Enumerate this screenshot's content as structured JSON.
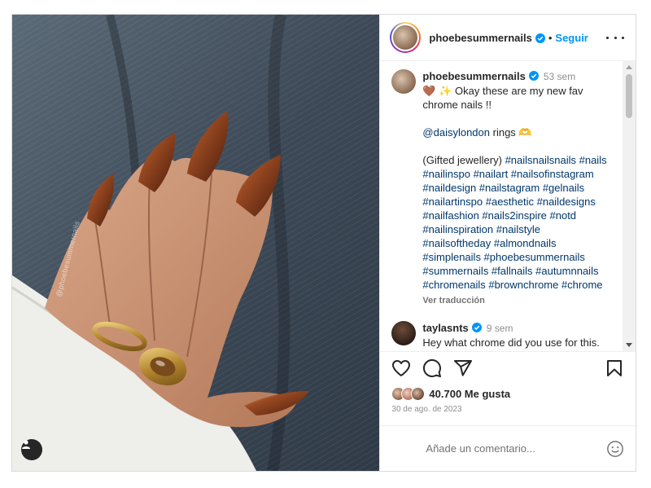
{
  "post": {
    "watermark": "@phoebesummernails",
    "author": {
      "username": "phoebesummernails",
      "verified": true,
      "follow_label": "Seguir",
      "separator": "•"
    },
    "caption": {
      "username": "phoebesummernails",
      "time": "53 sem",
      "emoji": "🤎 ✨",
      "line1": "Okay these are my new fav chrome nails !!",
      "mention": "@daisylondon",
      "mention_suffix": "rings 🫶",
      "gifted": "(Gifted jewellery)",
      "hashtags": "#nailsnailsnails #nails #nailinspo #nailart #nailsofinstagram #naildesign #nailstagram #gelnails #nailartinspo #aesthetic #naildesigns #nailfashion #nails2inspire #notd #nailinspiration #nailstyle #nailsoftheday #almondnails #simplenails #phoebesummernails #summernails #fallnails #autumnnails #chromenails #brownchrome #chrome",
      "translate": "Ver traducción"
    },
    "reply": {
      "username": "taylasnts",
      "time": "9 sem",
      "text": "Hey what chrome did you use for this. Looking through the"
    },
    "likes": "40.700 Me gusta",
    "date": "30 de ago. de 2023",
    "comment_placeholder": "Añade un comentario..."
  },
  "icons": {
    "like": "heart-icon",
    "comment": "comment-icon",
    "share": "share-icon",
    "save": "bookmark-icon",
    "emoji": "emoji-icon",
    "tagged_users": "user-icon",
    "more": "more-options-icon"
  },
  "colors": {
    "link": "#0095f6",
    "hashtag": "#00376b",
    "muted": "#8e8e8e",
    "verified": "#0095f6"
  }
}
